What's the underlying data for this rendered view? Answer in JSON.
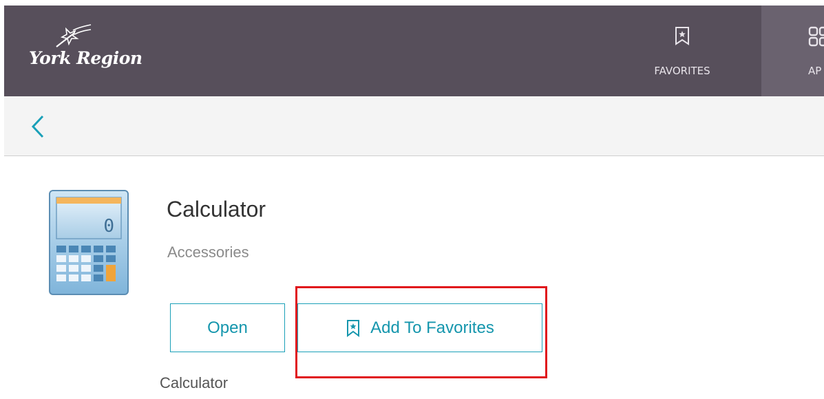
{
  "header": {
    "logo_text": "York Region",
    "nav": {
      "favorites_label": "FAVORITES",
      "apps_label": "AP",
      "favorites_icon": "bookmark-star-icon",
      "apps_icon": "apps-grid-icon"
    }
  },
  "subbar": {
    "back_icon": "chevron-left-icon"
  },
  "app": {
    "title": "Calculator",
    "category": "Accessories",
    "description": "Calculator",
    "icon": "calculator-icon",
    "calc_display": "0"
  },
  "actions": {
    "open_label": "Open",
    "add_favorites_label": "Add To Favorites"
  },
  "colors": {
    "header_bg": "#574f5b",
    "apps_tab_bg": "#6a626f",
    "accent": "#1596ad",
    "highlight": "#e0141b"
  }
}
